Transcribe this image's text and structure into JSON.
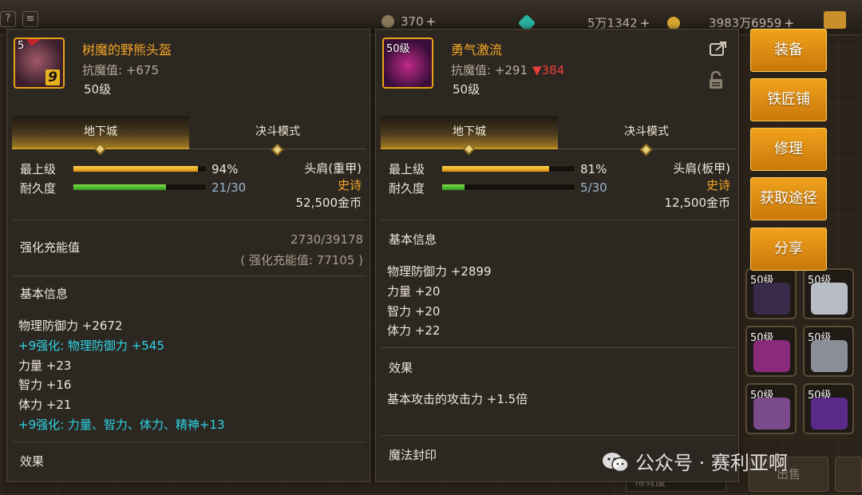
{
  "topbar": {
    "resource1": "370",
    "resource2": "5万1342",
    "resource3": "3983万6959",
    "plus": "+"
  },
  "left_card": {
    "item_level_badge": "5",
    "enhance_badge": "9",
    "name": "树魔的野熊头盔",
    "anti_magic": "抗魔值: +675",
    "level": "50级",
    "tab_dungeon": "地下城",
    "tab_duel": "决斗模式",
    "stat1_label": "最上级",
    "stat1_percent": 94,
    "stat1_value": "94%",
    "stat2_label": "耐久度",
    "stat2_fraction": 0.7,
    "stat2_value": "21/30",
    "slot_type": "头肩(重甲)",
    "rarity": "史诗",
    "price": "52,500金币",
    "charge_title": "强化充能值",
    "charge_progress": "2730/39178",
    "charge_value": "( 强化充能值: 77105 )",
    "basic_info_title": "基本信息",
    "lines": [
      {
        "text": "物理防御力 +2672",
        "cyan": false
      },
      {
        "text": "+9强化: 物理防御力 +545",
        "cyan": true
      },
      {
        "text": "力量 +23",
        "cyan": false
      },
      {
        "text": "智力 +16",
        "cyan": false
      },
      {
        "text": "体力 +21",
        "cyan": false
      },
      {
        "text": "+9强化: 力量、智力、体力、精神+13",
        "cyan": true
      }
    ],
    "effect_title": "效果"
  },
  "right_card": {
    "item_level_badge": "50级",
    "name": "勇气激流",
    "anti_magic": "抗魔值: +291",
    "anti_magic_diff": "▼384",
    "level": "50级",
    "tab_dungeon": "地下城",
    "tab_duel": "决斗模式",
    "stat1_label": "最上级",
    "stat1_percent": 81,
    "stat1_value": "81%",
    "stat2_label": "耐久度",
    "stat2_fraction": 0.1667,
    "stat2_value": "5/30",
    "slot_type": "头肩(板甲)",
    "rarity": "史诗",
    "price": "12,500金币",
    "basic_info_title": "基本信息",
    "lines": [
      "物理防御力 +2899",
      "力量 +20",
      "智力 +20",
      "体力 +22"
    ],
    "effect_title": "效果",
    "effect_text": "基本攻击的攻击力 +1.5倍",
    "seal_title": "魔法封印"
  },
  "actions": [
    "装备",
    "铁匠铺",
    "修理",
    "获取途径",
    "分享"
  ],
  "inventory_slots": [
    {
      "level": "50级",
      "color": "#3a2a4a"
    },
    {
      "level": "50级",
      "color": "#b8bcc4"
    },
    {
      "level": "50级",
      "color": "#8a2a7a"
    },
    {
      "level": "50级",
      "color": "#8a8e96"
    },
    {
      "level": "50级",
      "color": "#7a4a8a"
    },
    {
      "level": "50级",
      "color": "#5a2a8a"
    }
  ],
  "bottom": {
    "dropdown": "稀有度",
    "button": "出售"
  },
  "watermark": "公众号 · 赛利亚啊",
  "colors": {
    "accent_orange": "#f2a526",
    "cyan": "#2dd4e6",
    "down_red": "#e8403a",
    "button_orange": "#e8941a"
  },
  "icons": [
    "share-icon",
    "lock-icon",
    "wechat-icon"
  ]
}
